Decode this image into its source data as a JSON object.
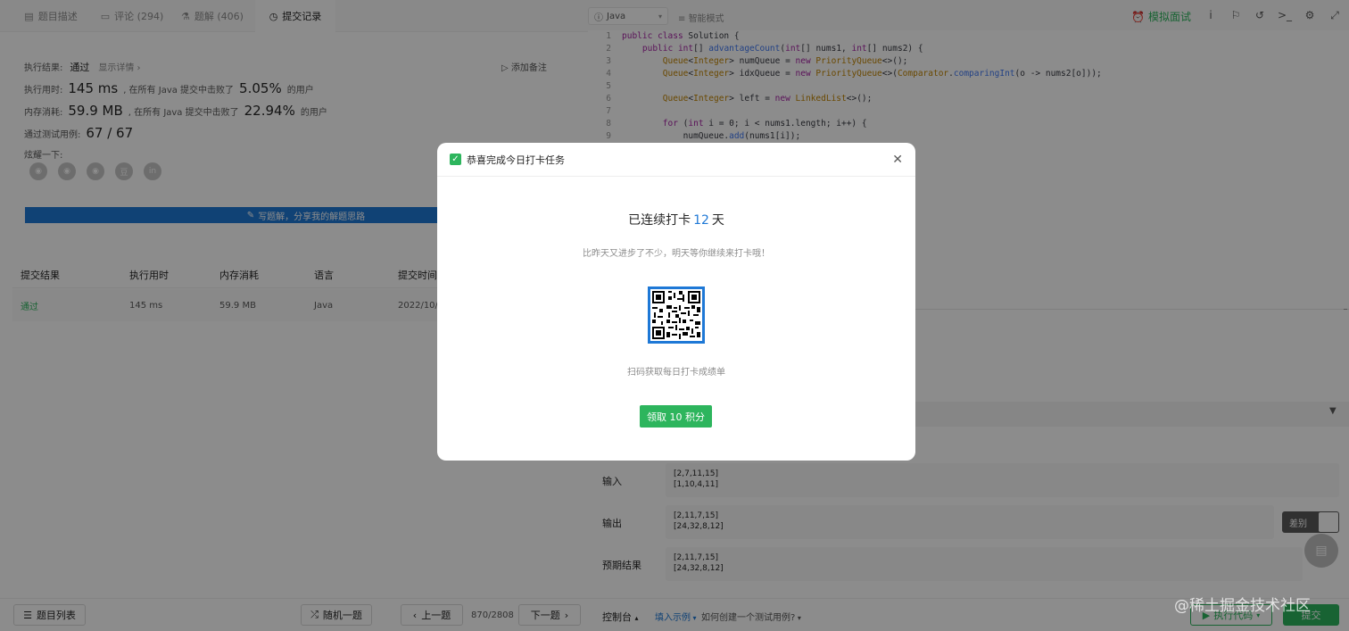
{
  "tabs": [
    {
      "label": "题目描述",
      "icon": "description-icon"
    },
    {
      "label": "评论 (294)",
      "icon": "comment-icon"
    },
    {
      "label": "题解 (406)",
      "icon": "flask-icon"
    },
    {
      "label": "提交记录",
      "icon": "clock-icon"
    }
  ],
  "editor_toolbar": {
    "language": "Java",
    "format": "智能模式",
    "mock_interview": "模拟面试"
  },
  "result": {
    "status_label": "执行结果:",
    "status": "通过",
    "detail_link": "显示详情 ›",
    "add_note": "添加备注",
    "time_label": "执行用时:",
    "time_value": "145 ms",
    "time_mid": ", 在所有 Java 提交中击败了",
    "time_pct": "5.05%",
    "time_suffix": "的用户",
    "mem_label": "内存消耗:",
    "mem_value": "59.9 MB",
    "mem_mid": ", 在所有 Java 提交中击败了",
    "mem_pct": "22.94%",
    "mem_suffix": "的用户",
    "cases_label": "通过测试用例:",
    "cases_value": "67 / 67",
    "share_label": "炫耀一下:",
    "write_solution": "写题解，分享我的解题思路"
  },
  "submissions": {
    "headers": [
      "提交结果",
      "执行用时",
      "内存消耗",
      "语言",
      "提交时间"
    ],
    "row": [
      "通过",
      "145 ms",
      "59.9 MB",
      "Java",
      "2022/10/"
    ]
  },
  "code_lines": [
    "public class Solution {",
    "    public int[] advantageCount(int[] nums1, int[] nums2) {",
    "        Queue<Integer> numQueue = new PriorityQueue<>();",
    "        Queue<Integer> idxQueue = new PriorityQueue<>(Comparator.comparingInt(o -> nums2[o]));",
    "",
    "        Queue<Integer> left = new LinkedList<>();",
    "",
    "        for (int i = 0; i < nums1.length; i++) {",
    "            numQueue.add(nums1[i]);"
  ],
  "console": {
    "input_label": "输入",
    "input_lines": [
      "[2,7,11,15]",
      "[1,10,4,11]"
    ],
    "output_label": "输出",
    "output_lines": [
      "[2,11,7,15]",
      "[24,32,8,12]"
    ],
    "expected_label": "预期结果",
    "expected_lines": [
      "[2,11,7,15]",
      "[24,32,8,12]"
    ],
    "diff_label": "差别"
  },
  "bottom": {
    "problem_list": "题目列表",
    "random": "随机一题",
    "prev": "上一题",
    "page": "870/2808",
    "next": "下一题",
    "console": "控制台",
    "fill_example": "填入示例",
    "how_create": "如何创建一个测试用例?",
    "run": "执行代码",
    "submit": "提交"
  },
  "modal": {
    "title": "恭喜完成今日打卡任务",
    "streak_prefix": "已连续打卡",
    "streak_days": "12",
    "streak_suffix": "天",
    "encourage": "比昨天又进步了不少，明天等你继续来打卡哦！",
    "scan_text": "扫码获取每日打卡成绩单",
    "claim_button": "领取 10 积分"
  },
  "watermark": "@稀土掘金技术社区",
  "colors": {
    "accent_green": "#2db55d",
    "accent_blue": "#1e78d6"
  }
}
